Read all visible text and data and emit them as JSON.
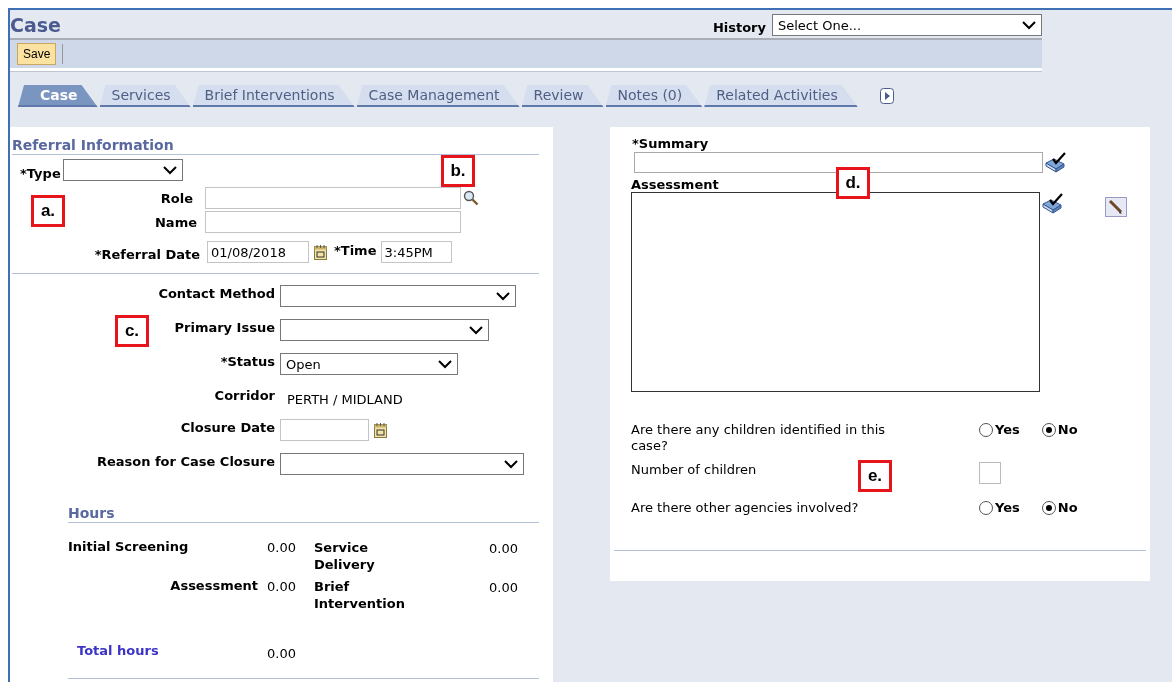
{
  "page": {
    "title": "Case"
  },
  "history": {
    "label": "History",
    "value": "Select One..."
  },
  "toolbar": {
    "buttons": [
      "Save"
    ]
  },
  "tabs": [
    {
      "label": "Case",
      "selected": true
    },
    {
      "label": "Services",
      "selected": false
    },
    {
      "label": "Brief Interventions",
      "selected": false
    },
    {
      "label": "Case Management",
      "selected": false
    },
    {
      "label": "Review",
      "selected": false
    },
    {
      "label": "Notes (0)",
      "selected": false
    },
    {
      "label": "Related Activities",
      "selected": false
    }
  ],
  "referral": {
    "title": "Referral Information",
    "type": {
      "label": "*Type"
    },
    "role": {
      "label": "Role"
    },
    "name": {
      "label": "Name"
    },
    "referral_date": {
      "label": "*Referral Date",
      "value": "01/08/2018"
    },
    "time": {
      "label": "*Time",
      "value": "3:45PM"
    }
  },
  "details": [
    {
      "label": "Contact Method",
      "kind": "select"
    },
    {
      "label": "Primary Issue",
      "kind": "select"
    },
    {
      "label": "*Status",
      "kind": "select",
      "value": "Open"
    },
    {
      "label": "Corridor",
      "kind": "display",
      "value": "PERTH / MIDLAND"
    },
    {
      "label": "Closure Date",
      "kind": "date"
    },
    {
      "label": "Reason for Case Closure",
      "kind": "select"
    }
  ],
  "hours": {
    "title": "Hours",
    "items": [
      {
        "label": "Initial Screening",
        "value": "0.00"
      },
      {
        "label": "Service Delivery",
        "value": "0.00"
      },
      {
        "label": "Assessment",
        "value": "0.00"
      },
      {
        "label": "Brief Intervention",
        "value": "0.00"
      }
    ],
    "total": {
      "label": "Total hours",
      "value": "0.00"
    }
  },
  "summary": {
    "label": "*Summary"
  },
  "assessment": {
    "label": "Assessment"
  },
  "questions": [
    {
      "text": "Are there any children identified in this case?",
      "kind": "radio",
      "options": [
        {
          "label": "Yes",
          "selected": false
        },
        {
          "label": "No",
          "selected": true
        }
      ]
    },
    {
      "text": "Number of children",
      "kind": "box"
    },
    {
      "text": "Are there other agencies involved?",
      "kind": "radio",
      "options": [
        {
          "label": "Yes",
          "selected": false
        },
        {
          "label": "No",
          "selected": true
        }
      ]
    }
  ],
  "callouts": [
    "a.",
    "b.",
    "c.",
    "d.",
    "e."
  ]
}
